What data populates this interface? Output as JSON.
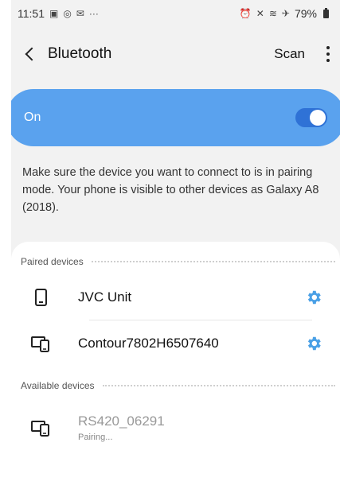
{
  "status_bar": {
    "time": "11:51",
    "battery": "79%"
  },
  "appbar": {
    "title": "Bluetooth",
    "scan_label": "Scan"
  },
  "toggle": {
    "label": "On",
    "enabled": true,
    "accent": "#5aa2ee"
  },
  "hint_text": "Make sure the device you want to connect to is in pairing mode. Your phone is visible to other devices as Galaxy A8 (2018).",
  "paired": {
    "header": "Paired devices",
    "devices": [
      {
        "name": "JVC Unit",
        "icon": "phone-icon"
      },
      {
        "name": "Contour7802H6507640",
        "icon": "computer-icon"
      }
    ]
  },
  "available": {
    "header": "Available devices",
    "devices": [
      {
        "name": "RS420_06291",
        "status": "Pairing...",
        "icon": "computer-icon"
      }
    ]
  },
  "colors": {
    "gear": "#4aa0e6"
  }
}
